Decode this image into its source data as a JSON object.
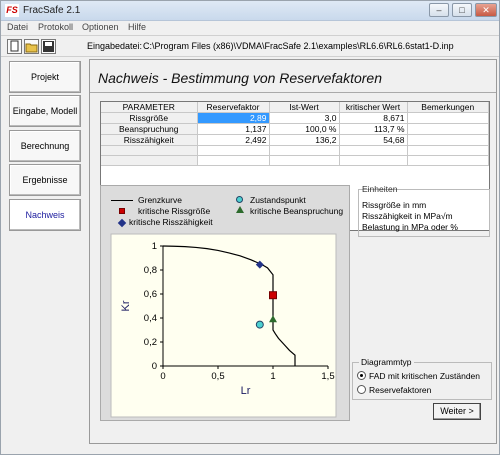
{
  "window": {
    "title": "FracSafe 2.1",
    "app_icon": "FS"
  },
  "menu": [
    "Datei",
    "Protokoll",
    "Optionen",
    "Hilfe"
  ],
  "file": {
    "label": "Eingabedatei:",
    "path": "C:\\Program Files (x86)\\VDMA\\FracSafe 2.1\\examples\\RL6.6\\RL6.6stat1-D.inp"
  },
  "nav": [
    {
      "label": "Projekt"
    },
    {
      "label": "Eingabe, Modell"
    },
    {
      "label": "Berechnung"
    },
    {
      "label": "Ergebnisse"
    },
    {
      "label": "Nachweis"
    }
  ],
  "heading": "Nachweis - Bestimmung von Reservefaktoren",
  "table": {
    "headers": [
      "PARAMETER",
      "Reservefaktor",
      "Ist-Wert",
      "kritischer Wert",
      "Bemerkungen"
    ],
    "rows": [
      [
        "Rissgröße",
        "2,89",
        "3,0",
        "8,671",
        ""
      ],
      [
        "Beanspruchung",
        "1,137",
        "100,0 %",
        "113,7 %",
        ""
      ],
      [
        "Risszähigkeit",
        "2,492",
        "136,2",
        "54,68",
        ""
      ]
    ]
  },
  "legend": {
    "grenzkurve": "Grenzkurve",
    "zustandspunkt": "Zustandspunkt",
    "krit_riss": "kritische Rissgröße",
    "krit_bean": "kritische Beanspruchung",
    "krit_zaeh": "kritische Risszähigkeit"
  },
  "chart_data": {
    "type": "line",
    "xlabel": "Lr",
    "ylabel": "Kr",
    "xlim": [
      0,
      1.5
    ],
    "ylim": [
      0,
      1
    ],
    "x_ticks": [
      "0",
      "0,5",
      "1",
      "1,5"
    ],
    "y_ticks": [
      "0",
      "0,2",
      "0,4",
      "0,6",
      "0,8",
      "1"
    ],
    "grenzkurve": {
      "x": [
        0,
        0.1,
        0.2,
        0.3,
        0.4,
        0.5,
        0.6,
        0.7,
        0.8,
        0.9,
        0.95,
        1.0,
        1.0,
        1.02,
        1.05,
        1.1,
        1.15,
        1.2,
        1.2
      ],
      "y": [
        1,
        0.998,
        0.995,
        0.988,
        0.978,
        0.963,
        0.942,
        0.918,
        0.885,
        0.845,
        0.818,
        0.76,
        0.3,
        0.27,
        0.23,
        0.18,
        0.13,
        0.09,
        0
      ]
    },
    "zustandspunkt": {
      "x": 0.88,
      "y": 0.345
    },
    "kritische_rissgroesse": {
      "x": 1.0,
      "y": 0.59
    },
    "kritische_beanspruchung": {
      "x": 1.0,
      "y": 0.39
    },
    "kritische_risszaehigkeit": {
      "x": 0.88,
      "y": 0.845
    }
  },
  "units": {
    "title": "Einheiten",
    "lines": [
      "Rissgröße in mm",
      "Risszähigkeit in MPa√m",
      "Belastung in MPa oder %"
    ]
  },
  "diagrammtyp": {
    "title": "Diagrammtyp",
    "options": [
      "FAD mit kritischen Zuständen",
      "Reservefaktoren"
    ]
  },
  "next_button": "Weiter >"
}
